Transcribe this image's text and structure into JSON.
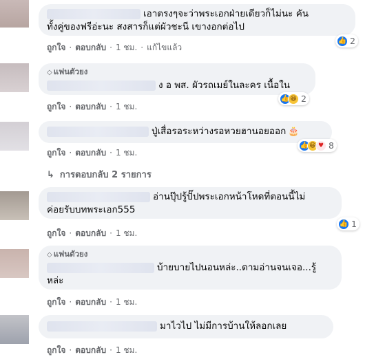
{
  "actions": {
    "like": "ถูกใจ",
    "reply": "ตอบกลับ",
    "dot": "·",
    "time": "1 ชม.",
    "edited": "แก้ไขแล้ว"
  },
  "fan_badge": "แฟนตัวยง",
  "replies_link": "การตอบกลับ 2 รายการ",
  "comments": [
    {
      "line1": "เอาตรงๆจะว่าพระเอกฝ่ายเดียวก็ไม่นะ คัน",
      "line2": "ทั้งคู่ของฟรีอ่ะนะ สงสารก็แต่ผัวชะนี เขางอกต่อไป",
      "reaction_count": "2"
    },
    {
      "line1": "ง อ พส. ผัวรถเมย์ในละคร เนื้อใน",
      "reaction_count": "2"
    },
    {
      "line1": "ปู่เสื่อรอระหว่างรอหวยฮานอยออก",
      "reaction_count": "8"
    },
    {
      "line1": "อ่านปุ๊ปรู้ปั๊ปพระเอกหน้าโหดที่ตอนนี้ไม่",
      "line2": "ค่อยรับบทพระเอก555",
      "reaction_count": "1"
    },
    {
      "line1": "บ้ายบายไปนอนหล่ะ..ตามอ่านจนเจอ...รู้",
      "line2": "หล่ะ"
    },
    {
      "line1": "มาไวไป ไม่มีการบ้านให้ลอกเลย"
    }
  ]
}
